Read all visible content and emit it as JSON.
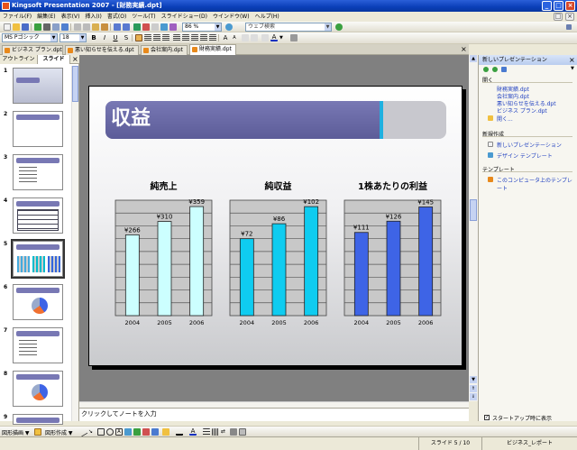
{
  "window": {
    "title": "Kingsoft Presentation 2007 - [財務実績.dpt]"
  },
  "menu": [
    "ファイル(F)",
    "編集(E)",
    "表示(V)",
    "挿入(I)",
    "書式(O)",
    "ツール(T)",
    "スライドショー(D)",
    "ウインドウ(W)",
    "ヘルプ(H)"
  ],
  "toolbar": {
    "zoom": "86 %",
    "search_placeholder": "ウェブ検索",
    "font_name": "MS Pゴシック",
    "font_size": "18"
  },
  "doc_tabs": [
    "ビジネス プラン.dpt",
    "悪い知らせを伝える.dpt",
    "会社案内.dpt",
    "財務実績.dpt"
  ],
  "left_panel": {
    "tabs": [
      "アウトライン",
      "スライド"
    ],
    "slide_numbers": [
      "1",
      "2",
      "3",
      "4",
      "5",
      "6",
      "7",
      "8",
      "9"
    ]
  },
  "slide": {
    "title": "収益",
    "colors": {
      "title_bar": "#6a6aa6",
      "series1": "#ccffff",
      "series2": "#0fccf0",
      "series3": "#3e64e6"
    },
    "chart_data": [
      {
        "type": "bar",
        "title": "純売上",
        "categories": [
          "2004",
          "2005",
          "2006"
        ],
        "values": [
          266,
          310,
          359
        ],
        "labels": [
          "¥266",
          "¥310",
          "¥359"
        ],
        "ylim": [
          0,
          380
        ],
        "color": "#ccffff"
      },
      {
        "type": "bar",
        "title": "純収益",
        "categories": [
          "2004",
          "2005",
          "2006"
        ],
        "values": [
          72,
          86,
          102
        ],
        "labels": [
          "¥72",
          "¥86",
          "¥102"
        ],
        "ylim": [
          0,
          108
        ],
        "color": "#0fccf0"
      },
      {
        "type": "bar",
        "title": "1株あたりの利益",
        "categories": [
          "2004",
          "2005",
          "2006"
        ],
        "values": [
          111,
          126,
          145
        ],
        "labels": [
          "¥111",
          "¥126",
          "¥145"
        ],
        "ylim": [
          0,
          154
        ],
        "color": "#3e64e6"
      }
    ]
  },
  "notes": {
    "placeholder": "クリックしてノートを入力"
  },
  "task_pane": {
    "title": "新しいプレゼンテーション",
    "sections": [
      {
        "heading": "開く",
        "links": [
          "財務実績.dpt",
          "会社案内.dpt",
          "悪い知らせを伝える.dpt",
          "ビジネス プラン.dpt",
          "開く..."
        ]
      },
      {
        "heading": "新規作成",
        "links": [
          "新しいプレゼンテーション",
          "デザイン テンプレート"
        ]
      },
      {
        "heading": "テンプレート",
        "links": [
          "このコンピュータ上のテンプレート"
        ]
      }
    ],
    "startup_checkbox": "スタートアップ時に表示"
  },
  "drawbar": {
    "draw_label": "図形描画",
    "autoshape_label": "図形作成"
  },
  "status": {
    "slide": "スライド 5 / 10",
    "design": "ビジネス_レポート"
  }
}
